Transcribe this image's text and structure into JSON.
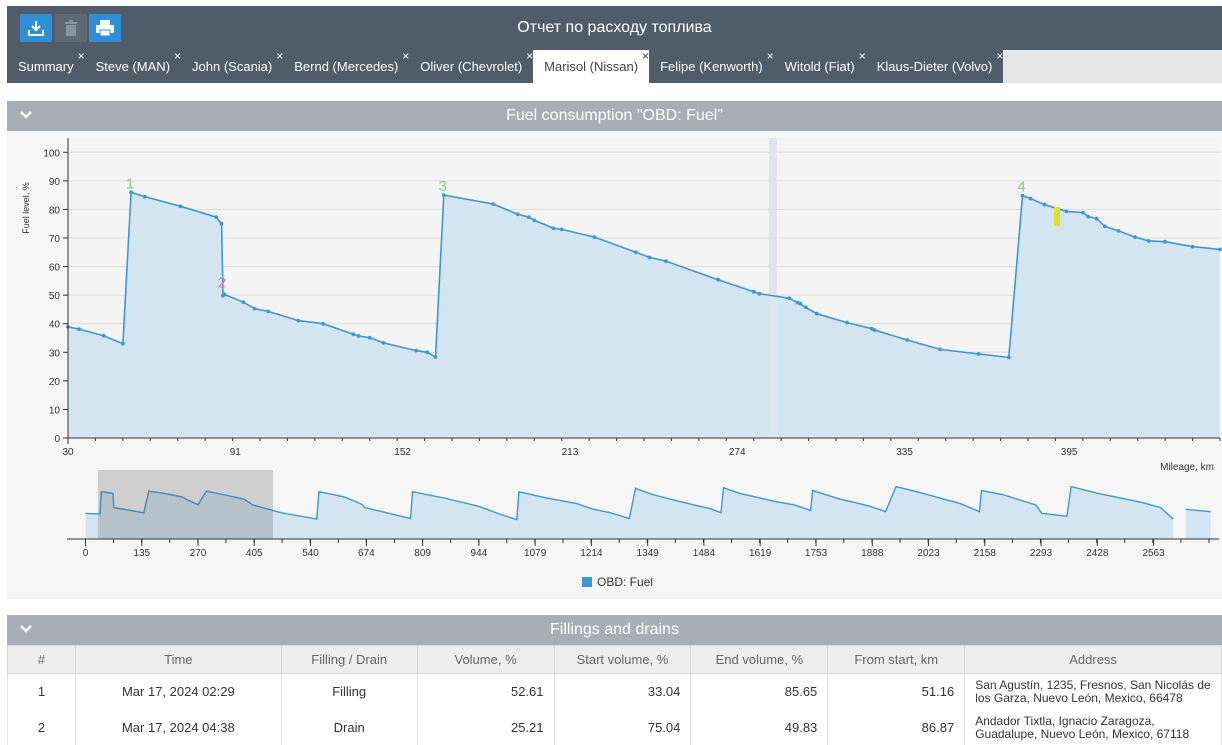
{
  "header": {
    "title": "Отчет по расходу топлива"
  },
  "toolbar": {
    "export_icon": "download-icon",
    "delete_icon": "trash-icon",
    "print_icon": "printer-icon"
  },
  "tabs": [
    {
      "label": "Summary"
    },
    {
      "label": "Steve (MAN)"
    },
    {
      "label": "John (Scania)"
    },
    {
      "label": "Bernd (Mercedes)"
    },
    {
      "label": "Oliver (Chevrolet)"
    },
    {
      "label": "Marisol (Nissan)",
      "active": true
    },
    {
      "label": "Felipe (Kenworth)"
    },
    {
      "label": "Witold (Fiat)"
    },
    {
      "label": "Klaus-Dieter (Volvo)"
    }
  ],
  "close_glyph": "×",
  "fuel_section": {
    "title": "Fuel consumption \"OBD: Fuel\""
  },
  "fillings_section": {
    "title": "Fillings and drains"
  },
  "colors": {
    "series": "#3d97d6",
    "fill": "#d4e5f2",
    "header": "#505d69",
    "section": "#a9adb5",
    "filling_marker": "#8cc87c",
    "drain_marker": "#f07c8c",
    "highlight": "#d8e628"
  },
  "chart_data": {
    "type": "area",
    "ylabel": "Fuel level, %",
    "xlabel": "Mileage, km",
    "xlim": [
      30,
      450
    ],
    "ylim": [
      0,
      105
    ],
    "x_ticks": [
      30,
      91,
      152,
      213,
      274,
      335,
      395
    ],
    "y_ticks": [
      0,
      10,
      20,
      30,
      40,
      50,
      60,
      70,
      80,
      90,
      100
    ],
    "legend": [
      "OBD: Fuel"
    ],
    "legend_position": "bottom",
    "series": [
      {
        "name": "OBD: Fuel",
        "x": [
          30,
          34,
          43,
          50,
          53,
          58,
          71,
          84,
          86,
          86.5,
          87,
          94,
          98,
          103,
          114,
          123,
          134,
          136,
          140,
          145,
          157,
          161,
          164,
          167,
          185,
          194,
          198,
          200,
          207,
          210,
          222,
          237,
          242,
          248,
          267,
          280,
          282,
          293,
          296,
          297,
          299,
          303,
          314,
          323,
          324,
          336,
          348,
          362,
          373,
          378,
          381,
          386,
          394,
          400,
          402,
          405,
          408,
          413,
          419,
          424,
          430,
          440,
          450
        ],
        "y": [
          38.9,
          38.1,
          35.8,
          33.0,
          86.0,
          84.5,
          81.1,
          77.3,
          75.0,
          49.8,
          50.3,
          47.5,
          45.3,
          44.3,
          41.1,
          40.0,
          36.3,
          35.7,
          35.1,
          33.3,
          30.6,
          30.0,
          28.3,
          85.0,
          81.9,
          78.3,
          77.3,
          76.2,
          73.4,
          73.0,
          70.3,
          65.0,
          63.2,
          61.9,
          55.4,
          51.2,
          50.5,
          48.9,
          47.4,
          47.0,
          45.7,
          43.5,
          40.4,
          38.3,
          37.8,
          34.3,
          31.0,
          29.4,
          28.2,
          84.8,
          83.8,
          81.7,
          79.3,
          78.9,
          77.5,
          76.8,
          74.1,
          72.5,
          70.3,
          69.0,
          68.7,
          67.0,
          66.0
        ]
      }
    ],
    "events": [
      {
        "label": "1",
        "type": "filling",
        "x": 53,
        "y": 86.0
      },
      {
        "label": "2",
        "type": "drain",
        "x": 86.5,
        "y": 49.8
      },
      {
        "label": "3",
        "type": "filling",
        "x": 167,
        "y": 85.0
      },
      {
        "label": "4",
        "type": "filling",
        "x": 378,
        "y": 84.8
      }
    ],
    "overview": {
      "x_ticks": [
        0,
        135,
        270,
        405,
        540,
        674,
        809,
        944,
        1079,
        1214,
        1349,
        1484,
        1619,
        1753,
        1888,
        2023,
        2158,
        2293,
        2428,
        2563
      ],
      "xlim": [
        -30,
        2720
      ],
      "selected_range": [
        30,
        450
      ]
    }
  },
  "table": {
    "columns": [
      "#",
      "Time",
      "Filling / Drain",
      "Volume, %",
      "Start volume, %",
      "End volume, %",
      "From start, km",
      "Address"
    ],
    "rows": [
      [
        "1",
        "Mar 17, 2024 02:29",
        "Filling",
        "52.61",
        "33.04",
        "85.65",
        "51.16",
        "San Agustín, 1235, Fresnos, San Nicolás de los Garza, Nuevo León, Mexico, 66478"
      ],
      [
        "2",
        "Mar 17, 2024 04:38",
        "Drain",
        "25.21",
        "75.04",
        "49.83",
        "86.87",
        "Andador Tixtla, Ignacio Zaragoza, Guadalupe, Nuevo León, Mexico, 67118"
      ]
    ]
  }
}
